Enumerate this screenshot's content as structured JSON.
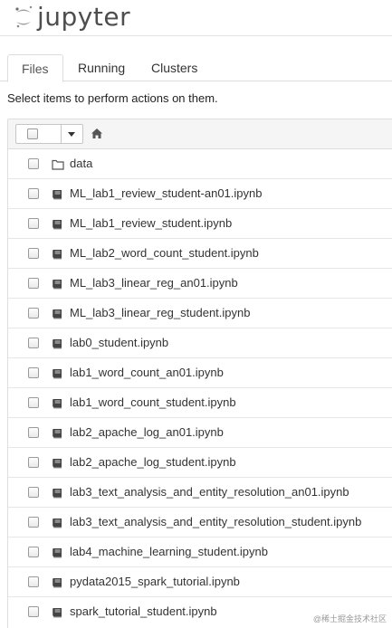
{
  "app": {
    "brand": "jupyter"
  },
  "tabs": [
    {
      "label": "Files",
      "active": true
    },
    {
      "label": "Running",
      "active": false
    },
    {
      "label": "Clusters",
      "active": false
    }
  ],
  "hint": "Select items to perform actions on them.",
  "toolbar": {
    "select_all_icon": "checkbox-icon",
    "dropdown_icon": "caret-down-icon",
    "home_icon": "home-icon"
  },
  "files": [
    {
      "name": "data",
      "type": "folder"
    },
    {
      "name": "ML_lab1_review_student-an01.ipynb",
      "type": "notebook"
    },
    {
      "name": "ML_lab1_review_student.ipynb",
      "type": "notebook"
    },
    {
      "name": "ML_lab2_word_count_student.ipynb",
      "type": "notebook"
    },
    {
      "name": "ML_lab3_linear_reg_an01.ipynb",
      "type": "notebook"
    },
    {
      "name": "ML_lab3_linear_reg_student.ipynb",
      "type": "notebook"
    },
    {
      "name": "lab0_student.ipynb",
      "type": "notebook"
    },
    {
      "name": "lab1_word_count_an01.ipynb",
      "type": "notebook"
    },
    {
      "name": "lab1_word_count_student.ipynb",
      "type": "notebook"
    },
    {
      "name": "lab2_apache_log_an01.ipynb",
      "type": "notebook"
    },
    {
      "name": "lab2_apache_log_student.ipynb",
      "type": "notebook"
    },
    {
      "name": "lab3_text_analysis_and_entity_resolution_an01.ipynb",
      "type": "notebook"
    },
    {
      "name": "lab3_text_analysis_and_entity_resolution_student.ipynb",
      "type": "notebook"
    },
    {
      "name": "lab4_machine_learning_student.ipynb",
      "type": "notebook"
    },
    {
      "name": "pydata2015_spark_tutorial.ipynb",
      "type": "notebook"
    },
    {
      "name": "spark_tutorial_student.ipynb",
      "type": "notebook"
    }
  ],
  "watermark": "@稀土掘金技术社区",
  "colors": {
    "logo_orange": "#f37726",
    "logo_text": "#4e4e4e",
    "border": "#dddddd",
    "header_bg": "#f5f5f5"
  }
}
